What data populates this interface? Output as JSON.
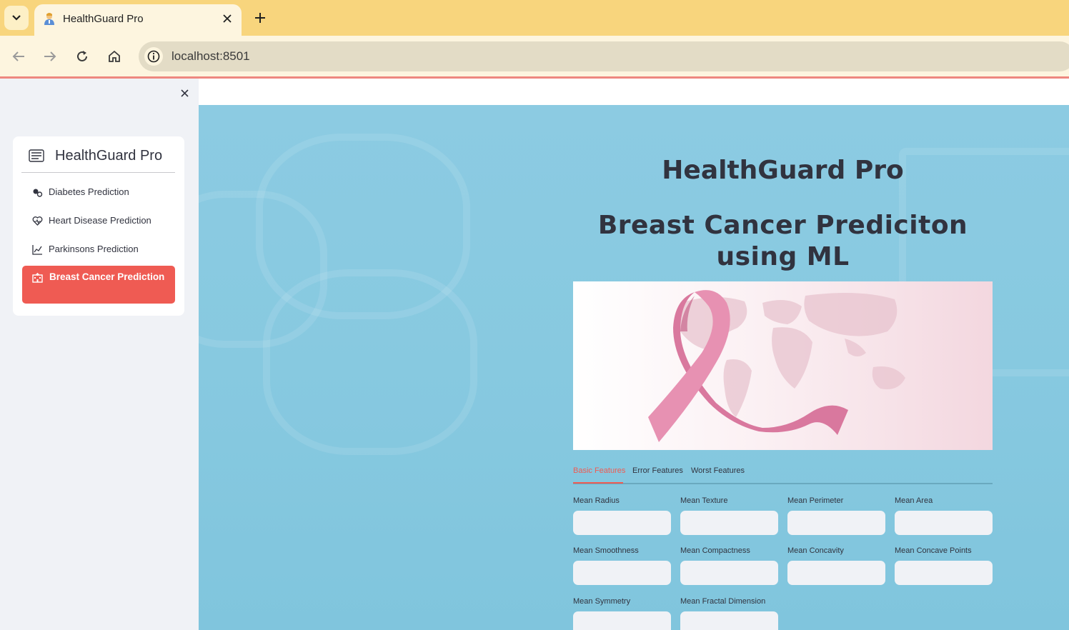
{
  "browser": {
    "tab_title": "HealthGuard Pro",
    "url": "localhost:8501"
  },
  "sidebar": {
    "title": "HealthGuard Pro",
    "items": [
      {
        "label": "Diabetes Prediction",
        "icon": "activity-icon"
      },
      {
        "label": "Heart Disease Prediction",
        "icon": "heart-pulse-icon"
      },
      {
        "label": "Parkinsons Prediction",
        "icon": "graph-up-icon"
      },
      {
        "label": "Breast Cancer Prediction",
        "icon": "hospital-icon",
        "active": true
      }
    ]
  },
  "main": {
    "title": "HealthGuard Pro",
    "subtitle": "Breast Cancer Prediciton using ML",
    "tabs": [
      "Basic Features",
      "Error Features",
      "Worst Features"
    ],
    "fields": [
      "Mean Radius",
      "Mean Texture",
      "Mean Perimeter",
      "Mean Area",
      "Mean Smoothness",
      "Mean Compactness",
      "Mean Concavity",
      "Mean Concave Points",
      "Mean Symmetry",
      "Mean Fractal Dimension"
    ]
  },
  "colors": {
    "accent": "#ef5b53",
    "tabbar": "#f8d57d",
    "main_bg": "#8ccbe2"
  }
}
